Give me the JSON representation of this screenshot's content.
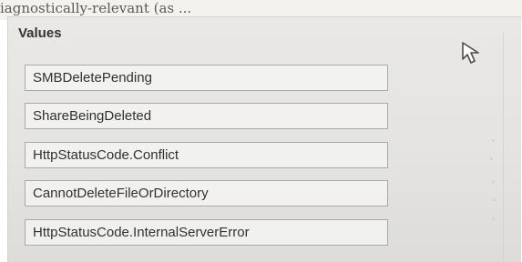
{
  "header_fragment": "iagnostically-relevant (as ...",
  "values_section": {
    "title": "Values",
    "items": [
      "SMBDeletePending",
      "ShareBeingDeleted",
      "HttpStatusCode.Conflict",
      "CannotDeleteFileOrDirectory",
      "HttpStatusCode.InternalServerError"
    ]
  },
  "icons": {
    "cursor": "mouse-pointer-icon"
  },
  "colors": {
    "panel": "#e6e5e3",
    "border": "#a9a9a9",
    "text": "#313131"
  }
}
